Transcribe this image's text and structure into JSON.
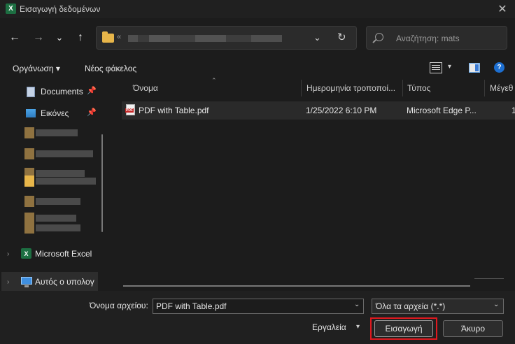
{
  "window": {
    "title": "Εισαγωγή δεδομένων",
    "app_icon": "excel-icon",
    "close_glyph": "✕",
    "app_letter": "X"
  },
  "nav": {
    "back_glyph": "←",
    "forward_glyph": "→",
    "recent_glyph": "⌄",
    "up_glyph": "↑",
    "address_prefix": "«",
    "address_dropdown_glyph": "⌄",
    "refresh_glyph": "↻",
    "search_placeholder": "Αναζήτηση: mats"
  },
  "toolbar": {
    "organize": "Οργάνωση ▾",
    "new_folder": "Νέος φάκελος",
    "view_dropdown": "▾",
    "help": "?"
  },
  "sidebar": {
    "items": [
      {
        "label": "Documents",
        "icon": "documents-icon",
        "pinned": true
      },
      {
        "label": "Εικόνες",
        "icon": "pictures-icon",
        "pinned": true
      },
      {
        "label": "Microsoft Excel",
        "icon": "excel-icon"
      },
      {
        "label": "Αυτός ο υπολογ",
        "icon": "pc-icon"
      }
    ],
    "pin_glyph": "📌",
    "chevron_glyph": "›"
  },
  "filelist": {
    "columns": [
      "Όνομα",
      "Ημερομηνία τροποποί...",
      "Τύπος",
      "Μέγεθ"
    ],
    "sort_glyph": "⌃",
    "rows": [
      {
        "name": "PDF with Table.pdf",
        "modified": "1/25/2022 6:10 PM",
        "type": "Microsoft Edge P...",
        "size": "1"
      }
    ]
  },
  "footer": {
    "filename_label": "Όνομα αρχείου:",
    "filename_value": "PDF with Table.pdf",
    "filetype_value": "Όλα τα αρχεία (*.*)",
    "tools_label": "Εργαλεία",
    "insert_button": "Εισαγωγή",
    "cancel_button": "Άκυρο",
    "dropdown_glyph": "⌄",
    "tools_drop_glyph": "▾"
  },
  "colors": {
    "accent": "#1d6fd1",
    "highlight": "#e0191f",
    "excel_green": "#1d6f42",
    "folder_yellow": "#e8b64a"
  }
}
